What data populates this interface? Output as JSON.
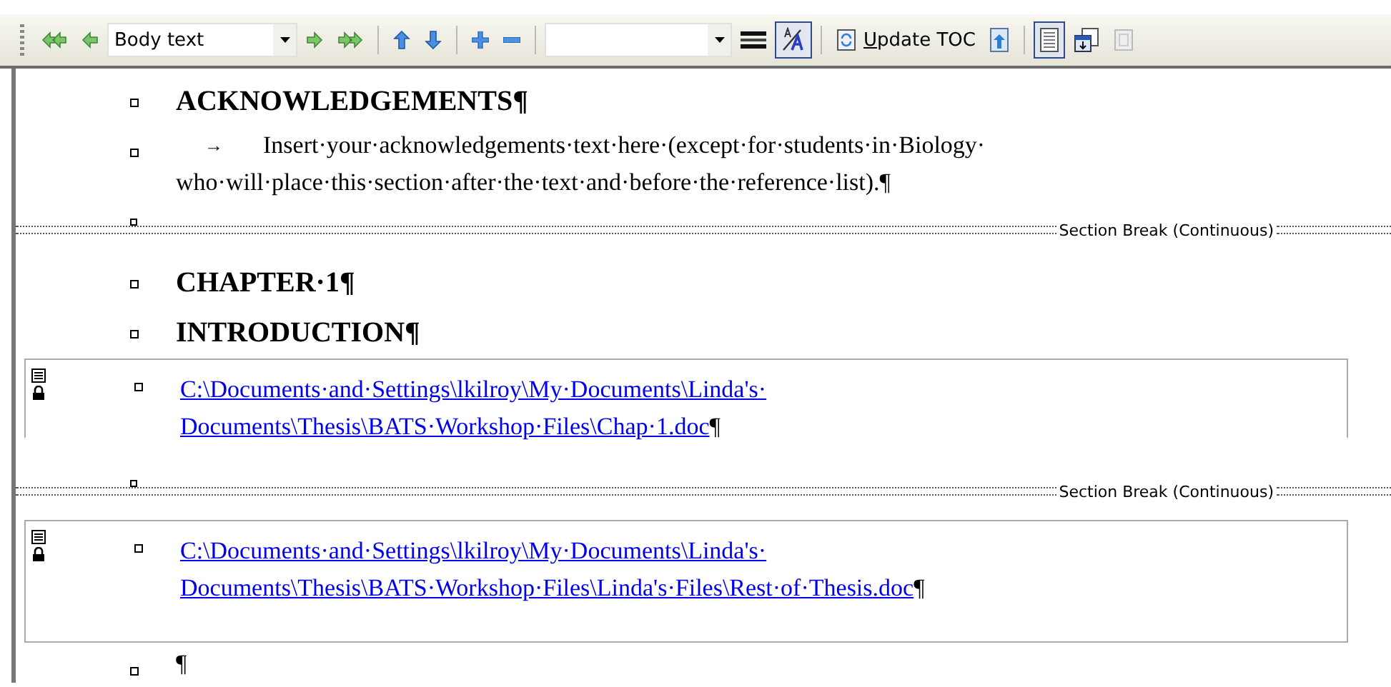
{
  "toolbar": {
    "style_box": {
      "value": "Body text"
    },
    "show_formatting": {
      "pressed": true
    },
    "update_toc": {
      "label": "Update TOC"
    },
    "master_view": {
      "pressed": true
    }
  },
  "document": [
    {
      "kind": "heading",
      "text": "ACKNOWLEDGEMENTS¶"
    },
    {
      "kind": "body",
      "tab_mark": "→",
      "lines": [
        "Insert·your·acknowledgements·text·here·(except·for·students·in·Biology·",
        "who·will·place·this·section·after·the·text·and·before·the·reference·list).¶"
      ]
    },
    {
      "kind": "section_break",
      "label": "Section Break (Continuous)"
    },
    {
      "kind": "heading",
      "text": "CHAPTER·1¶"
    },
    {
      "kind": "heading",
      "text": "INTRODUCTION¶"
    },
    {
      "kind": "subdoc",
      "locked": true,
      "closed": false,
      "lines": [
        "C:\\Documents·and·Settings\\lkilroy\\My·Documents\\Linda's·",
        "Documents\\Thesis\\BATS·Workshop·Files\\Chap·1.doc"
      ],
      "mark": "¶"
    },
    {
      "kind": "section_break",
      "label": "Section Break (Continuous)"
    },
    {
      "kind": "subdoc",
      "locked": true,
      "closed": true,
      "lines": [
        "C:\\Documents·and·Settings\\lkilroy\\My·Documents\\Linda's·",
        "Documents\\Thesis\\BATS·Workshop·Files\\Linda's·Files\\Rest·of·Thesis.doc"
      ],
      "mark": "¶"
    },
    {
      "kind": "body",
      "lines": [
        "¶"
      ]
    }
  ]
}
